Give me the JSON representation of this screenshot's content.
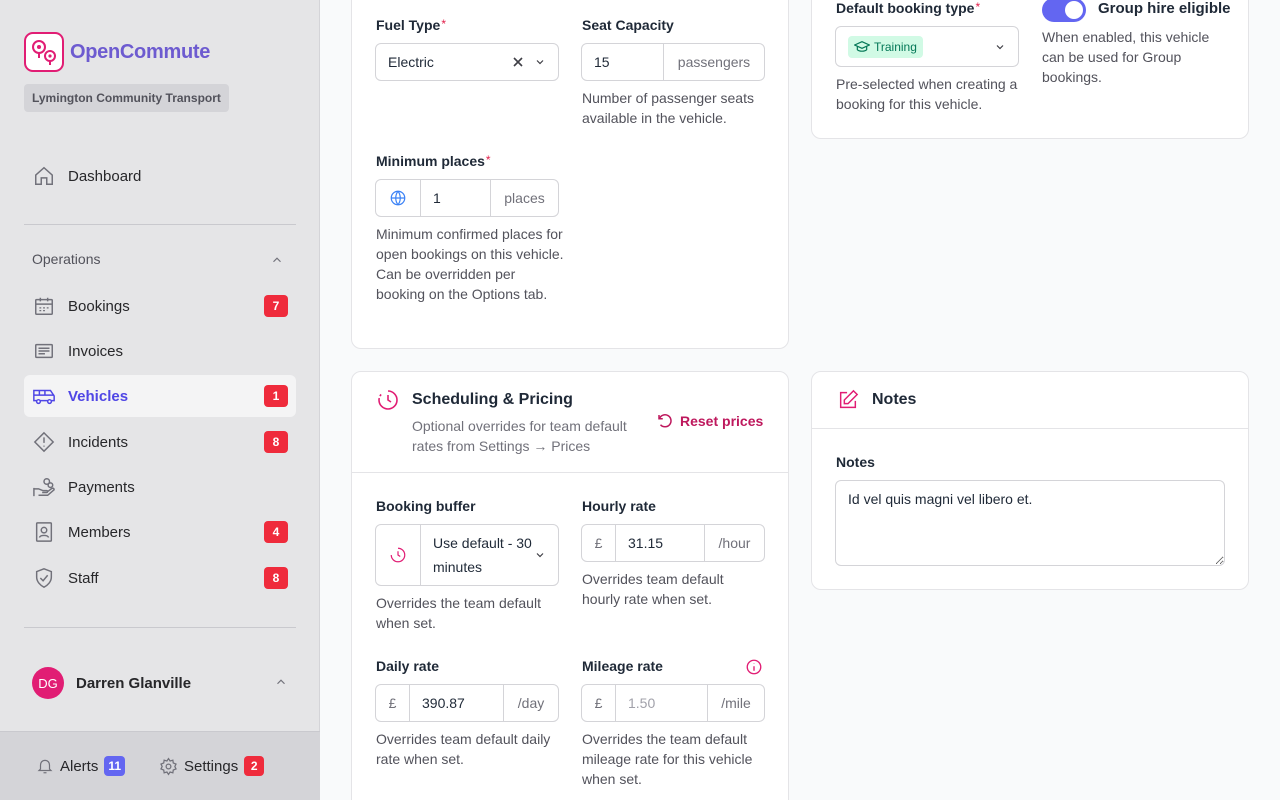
{
  "app": {
    "name": "OpenCommute",
    "organisation": "Lymington Community Transport"
  },
  "sidebar": {
    "dashboard": "Dashboard",
    "section_title": "Operations",
    "items": [
      {
        "label": "Bookings",
        "badge": "7"
      },
      {
        "label": "Invoices",
        "badge": ""
      },
      {
        "label": "Vehicles",
        "badge": "1"
      },
      {
        "label": "Incidents",
        "badge": "8"
      },
      {
        "label": "Payments",
        "badge": ""
      },
      {
        "label": "Members",
        "badge": "4"
      },
      {
        "label": "Staff",
        "badge": "8"
      }
    ],
    "user": {
      "initials": "DG",
      "name": "Darren Glanville"
    },
    "footer": {
      "alerts_label": "Alerts",
      "alerts_count": "11",
      "settings_label": "Settings",
      "settings_count": "2"
    }
  },
  "vehicle_details": {
    "fuel_type_label": "Fuel Type",
    "fuel_type_value": "Electric",
    "seat_capacity_label": "Seat Capacity",
    "seat_capacity_value": "15",
    "seat_capacity_unit": "passengers",
    "seat_capacity_help": "Number of passenger seats available in the vehicle.",
    "min_places_label": "Minimum places",
    "min_places_value": "1",
    "min_places_unit": "places",
    "min_places_help": "Minimum confirmed places for open bookings on this vehicle. Can be overridden per booking on the Options tab."
  },
  "booking_settings": {
    "default_booking_type_label": "Default booking type",
    "default_booking_type_value": "Training",
    "default_booking_type_help": "Pre-selected when creating a booking for this vehicle.",
    "group_hire_label": "Group hire eligible",
    "group_hire_enabled": true,
    "group_hire_help": "When enabled, this vehicle can be used for Group bookings."
  },
  "scheduling": {
    "title": "Scheduling & Pricing",
    "subtitle": "Optional overrides for team default rates from Settings → Prices",
    "reset_label": "Reset prices",
    "buffer_label": "Booking buffer",
    "buffer_value": "Use default - 30 minutes",
    "buffer_help": "Overrides the team default when set.",
    "hourly_label": "Hourly rate",
    "hourly_value": "31.15",
    "hourly_unit": "/hour",
    "hourly_help": "Overrides team default hourly rate when set.",
    "daily_label": "Daily rate",
    "daily_value": "390.87",
    "daily_unit": "/day",
    "daily_help": "Overrides team default daily rate when set.",
    "mileage_label": "Mileage rate",
    "mileage_placeholder": "1.50",
    "mileage_unit": "/mile",
    "mileage_help": "Overrides the team default mileage rate for this vehicle when set.",
    "currency": "£"
  },
  "notes": {
    "title": "Notes",
    "field_label": "Notes",
    "value": "Id vel quis magni vel libero et."
  },
  "colors": {
    "accent": "#6366f1",
    "brand": "#e11d74",
    "badge": "#ef2b3c"
  }
}
